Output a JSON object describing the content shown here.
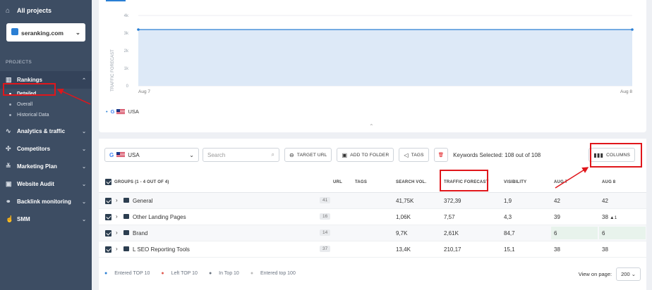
{
  "sidebar": {
    "all_projects": "All projects",
    "domain": "seranking.com",
    "section": "PROJECTS",
    "rankings": "Rankings",
    "sub": [
      "Detailed",
      "Overall",
      "Historical Data"
    ],
    "items": [
      "Analytics & traffic",
      "Competitors",
      "Marketing Plan",
      "Website Audit",
      "Backlink monitoring",
      "SMM"
    ]
  },
  "chart": {
    "ylabel": "TRAFFIC FORECAST",
    "y_ticks": [
      "4k",
      "3k",
      "2k",
      "1k",
      "0"
    ],
    "x_ticks": [
      "Aug 7",
      "Aug 8"
    ],
    "legend": "USA"
  },
  "chart_data": {
    "type": "area",
    "categories": [
      "Aug 7",
      "Aug 8"
    ],
    "series": [
      {
        "values": [
          3200,
          3200
        ]
      }
    ],
    "ylim": [
      0,
      4000
    ],
    "ylabel": "TRAFFIC FORECAST"
  },
  "toolbar": {
    "country": "USA",
    "search_placeholder": "Search",
    "target_url": "TARGET URL",
    "add_folder": "ADD TO FOLDER",
    "tags": "TAGS",
    "selected": "Keywords Selected: 108 out of 108",
    "columns": "COLUMNS"
  },
  "table": {
    "headers": [
      "GROUPS (1 - 4 OUT OF 4)",
      "URL",
      "TAGS",
      "SEARCH VOL.",
      "TRAFFIC FORECAST",
      "VISIBILITY",
      "AUG 7",
      "AUG 8"
    ],
    "rows": [
      {
        "name": "General",
        "count": "41",
        "vol": "41,75K",
        "tf": "372,39",
        "vis": "1,9",
        "a7": "42",
        "a8": "42",
        "chg": ""
      },
      {
        "name": "Other Landing Pages",
        "count": "16",
        "vol": "1,06K",
        "tf": "7,57",
        "vis": "4,3",
        "a7": "39",
        "a8": "38",
        "chg": "▲1"
      },
      {
        "name": "Brand",
        "count": "14",
        "vol": "9,7K",
        "tf": "2,61K",
        "vis": "84,7",
        "a7": "6",
        "a8": "6",
        "chg": ""
      },
      {
        "name": "L SEO Reporting Tools",
        "count": "37",
        "vol": "13,4K",
        "tf": "210,17",
        "vis": "15,1",
        "a7": "38",
        "a8": "38",
        "chg": ""
      }
    ]
  },
  "footer": {
    "legend": [
      "Entered TOP 10",
      "Left TOP 10",
      "In Top 10",
      "Entered top 100"
    ],
    "view_label": "View on page:",
    "view_value": "200"
  }
}
